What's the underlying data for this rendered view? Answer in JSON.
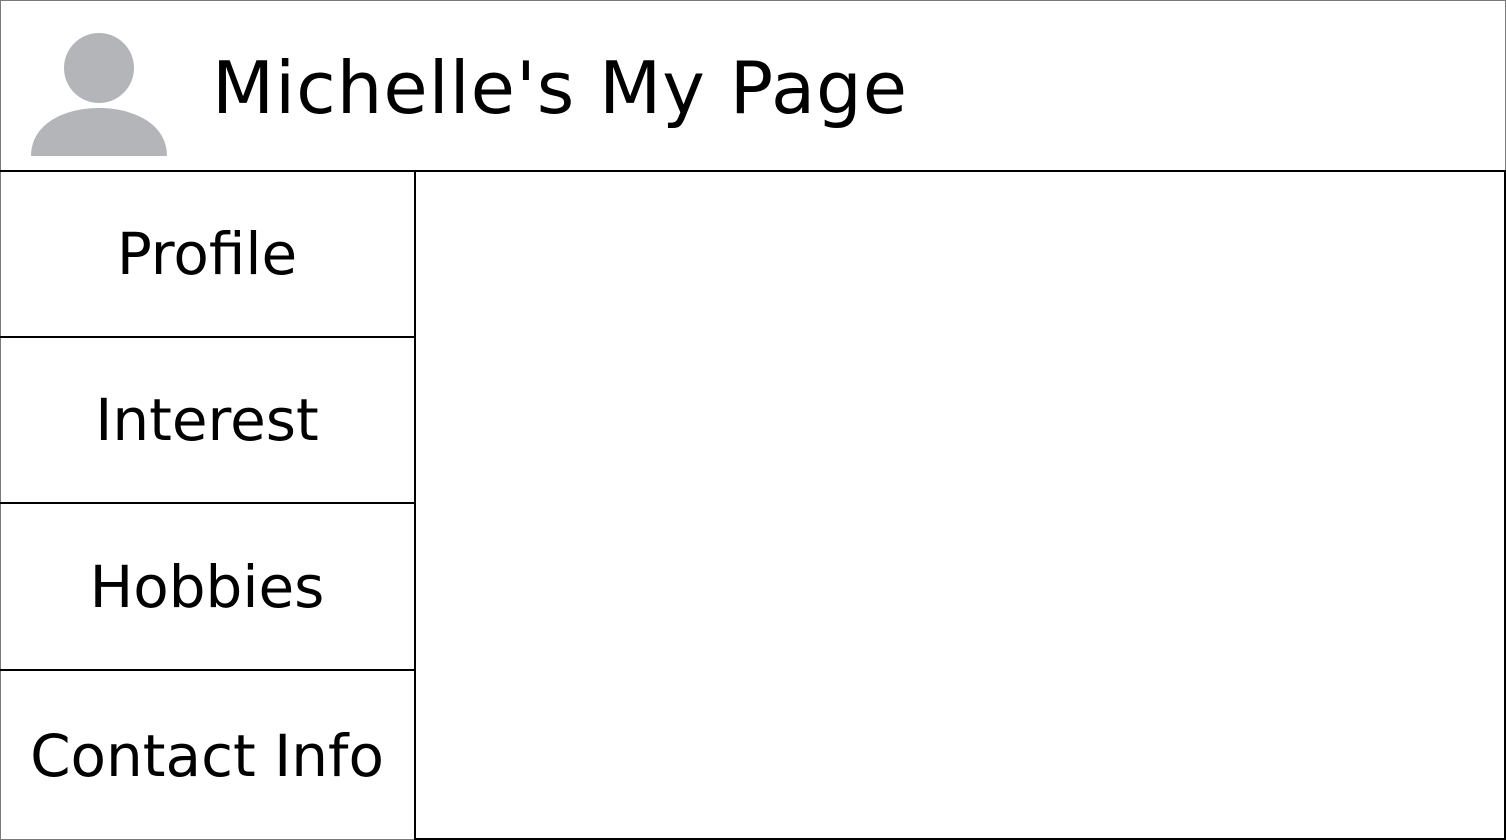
{
  "header": {
    "title": "Michelle's My Page",
    "avatar_icon": "user-silhouette-icon",
    "avatar_color": "#b3b5b9"
  },
  "sidebar": {
    "items": [
      {
        "label": "Profile"
      },
      {
        "label": "Interest"
      },
      {
        "label": "Hobbies"
      },
      {
        "label": "Contact Info"
      }
    ]
  }
}
